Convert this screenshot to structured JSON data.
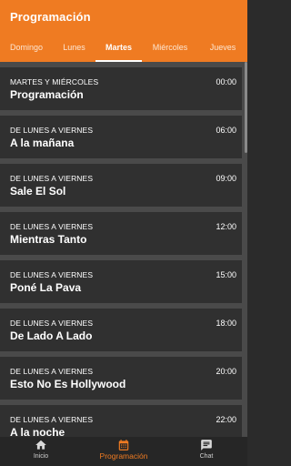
{
  "header": {
    "title": "Programación"
  },
  "tabs": [
    {
      "label": "Domingo"
    },
    {
      "label": "Lunes"
    },
    {
      "label": "Martes"
    },
    {
      "label": "Miércoles"
    },
    {
      "label": "Jueves"
    }
  ],
  "active_tab": "Martes",
  "schedule": [
    {
      "days": "MARTES Y MIÉRCOLES",
      "time": "00:00",
      "show": "Programación"
    },
    {
      "days": "DE LUNES A VIERNES",
      "time": "06:00",
      "show": "A la mañana"
    },
    {
      "days": "DE LUNES A VIERNES",
      "time": "09:00",
      "show": "Sale El Sol"
    },
    {
      "days": "DE LUNES A VIERNES",
      "time": "12:00",
      "show": "Mientras Tanto"
    },
    {
      "days": "DE LUNES A VIERNES",
      "time": "15:00",
      "show": "Poné La Pava"
    },
    {
      "days": "DE LUNES A VIERNES",
      "time": "18:00",
      "show": "De Lado A Lado"
    },
    {
      "days": "DE LUNES A VIERNES",
      "time": "20:00",
      "show": "Esto No Es Hollywood"
    },
    {
      "days": "DE LUNES A VIERNES",
      "time": "22:00",
      "show": "A la noche"
    }
  ],
  "bottom_nav": [
    {
      "label": "Inicio",
      "icon": "home-icon"
    },
    {
      "label": "Programación",
      "icon": "calendar-icon"
    },
    {
      "label": "Chat",
      "icon": "chat-icon"
    }
  ],
  "active_nav": "Programación",
  "colors": {
    "accent": "#ef7b22",
    "card_bg": "#303030",
    "divider": "#4a4a4a",
    "nav_bg": "#262626"
  }
}
